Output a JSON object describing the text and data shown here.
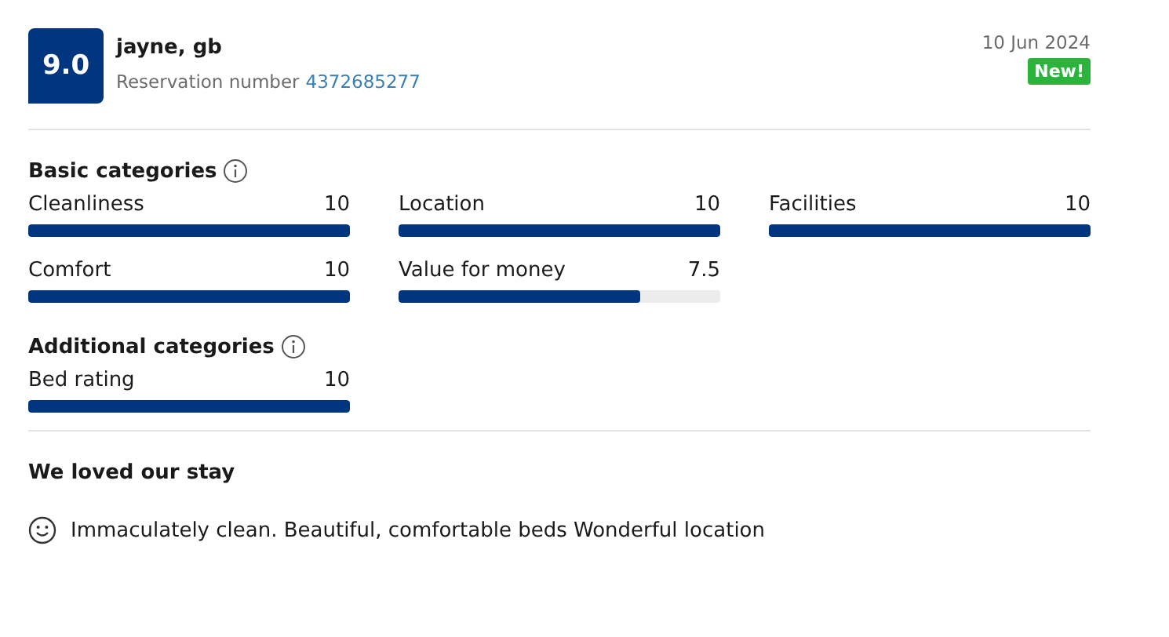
{
  "review": {
    "score": "9.0",
    "reviewer": "jayne, gb",
    "reservation_label": "Reservation number",
    "reservation_number": "4372685277",
    "date": "10 Jun 2024",
    "badge": "New!"
  },
  "sections": [
    {
      "title": "Basic categories",
      "ratings": [
        {
          "name": "Cleanliness",
          "value": "10",
          "level": 1
        },
        {
          "name": "Location",
          "value": "10",
          "level": 1
        },
        {
          "name": "Facilities",
          "value": "10",
          "level": 1
        },
        {
          "name": "Comfort",
          "value": "10",
          "level": 1
        },
        {
          "name": "Value for money",
          "value": "7.5",
          "level": 0.75
        }
      ]
    },
    {
      "title": "Additional categories",
      "ratings": [
        {
          "name": "Bed rating",
          "value": "10",
          "level": 1
        }
      ]
    }
  ],
  "comment": {
    "title": "We loved our stay",
    "text": "Immaculately clean. Beautiful, comfortable beds Wonderful location"
  }
}
